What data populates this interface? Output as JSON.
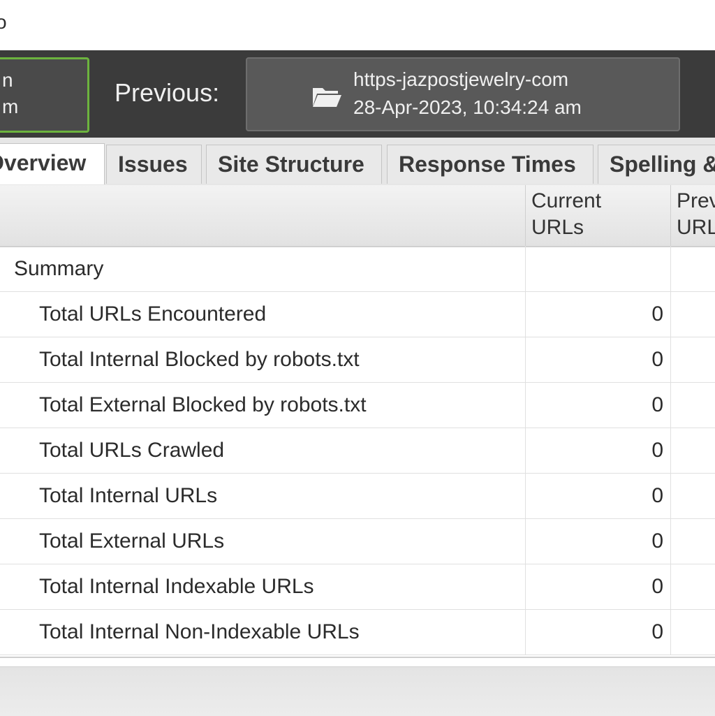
{
  "menu": {
    "text": "o"
  },
  "toolbar": {
    "current": {
      "line1": "n",
      "line2": "m"
    },
    "previous_label": "Previous:",
    "previous_crawl": {
      "name": "https-jazpostjewelry-com",
      "date": "28-Apr-2023, 10:34:24 am",
      "icon": "folder-open-icon"
    }
  },
  "tabs": [
    {
      "label": "Overview",
      "active": true
    },
    {
      "label": "Issues",
      "active": false
    },
    {
      "label": "Site Structure",
      "active": false
    },
    {
      "label": "Response Times",
      "active": false
    },
    {
      "label": "Spelling &",
      "active": false
    }
  ],
  "table": {
    "columns": [
      {
        "line1": "Current",
        "line2": "URLs"
      },
      {
        "line1": "Prev",
        "line2": "URL"
      }
    ],
    "group": "Summary",
    "rows": [
      {
        "label": "Total URLs Encountered",
        "current": "0"
      },
      {
        "label": "Total Internal Blocked by robots.txt",
        "current": "0"
      },
      {
        "label": "Total External Blocked by robots.txt",
        "current": "0"
      },
      {
        "label": "Total URLs Crawled",
        "current": "0"
      },
      {
        "label": "Total Internal URLs",
        "current": "0"
      },
      {
        "label": "Total External URLs",
        "current": "0"
      },
      {
        "label": "Total Internal Indexable URLs",
        "current": "0"
      },
      {
        "label": "Total Internal Non-Indexable URLs",
        "current": "0"
      }
    ]
  },
  "colors": {
    "toolbar_bg": "#3b3b3b",
    "accent_green": "#6cb33e"
  }
}
